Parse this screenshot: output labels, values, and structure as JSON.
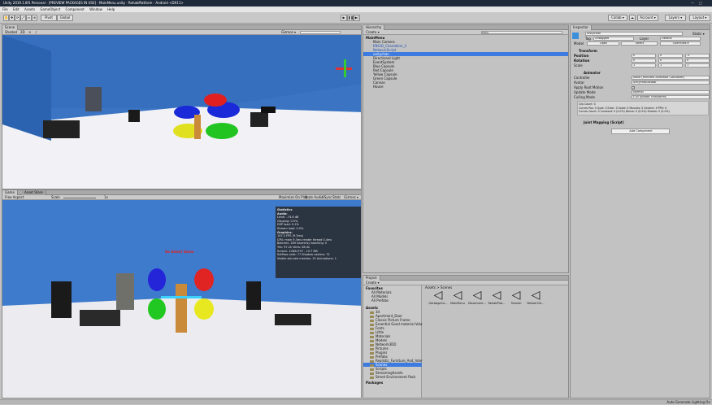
{
  "window": {
    "title": "Unity 2019.1.8f1 Personal - [PREVIEW PACKAGES IN USE] - MainMenu.unity - RehabPlatform - Android <DX11>",
    "minimize": "—",
    "maximize": "□"
  },
  "menu": [
    "File",
    "Edit",
    "Assets",
    "GameObject",
    "Component",
    "Window",
    "Help"
  ],
  "toolbar": {
    "pivot": "Pivot",
    "global": "Global",
    "collab": "Collab ▾",
    "account": "Account ▾",
    "layers": "Layers ▾",
    "layout": "Layout ▾"
  },
  "scene": {
    "tab": "Scene",
    "shaded": "Shaded",
    "mode2d": "2D",
    "gizmos": "Gizmos ▾"
  },
  "game": {
    "tab": "Game",
    "tab2": "Asset Store",
    "aspect": "Free Aspect",
    "scale": "Scale",
    "scale_value": "1x",
    "maximize": "Maximize On Play",
    "mute": "Mute Audio",
    "vsync": "VSync",
    "stats": "Stats",
    "gizmos": "Gizmos ▾",
    "red_text": "Go Select Game"
  },
  "stats_panel": {
    "title": "Statistics",
    "audio": "Audio:",
    "level": "Level: -74.8 dB",
    "clipping": "Clipping: 0.0%",
    "dsp": "DSP load: 0.1%",
    "stream": "Stream load: 0.0%",
    "graphics": "Graphics:",
    "fps": "107.2 FPS (9.3ms)",
    "cpu": "CPU: main 9.3ms  render thread 0.4ms",
    "batches": "Batches: 189   Saved by batching: 0",
    "tris": "Tris: 97.2k    Verts: 68.4k",
    "screen": "Screen: 1289x797 - 15.7 MB",
    "setpass": "SetPass calls: 77   Shadow casters: 72",
    "skinned": "Visible skinned meshes: 19  Animations: 1"
  },
  "hierarchy": {
    "tab": "Hierarchy",
    "create": "Create ▾",
    "search": "Q▾All",
    "items": [
      "MainMenu",
      "Main Camera",
      "ENGIO_Chandelier_2",
      "NetworkScript",
      "unitychan",
      "Directional Light",
      "EventSystem",
      "Blue Capsule",
      "Red Capsule",
      "Yellow Capsule",
      "Green Capsule",
      "Canvas",
      "House"
    ]
  },
  "project": {
    "tab": "Project",
    "create": "Create ▾",
    "favorites": "Favorites",
    "fav_items": [
      "All Materials",
      "All Models",
      "All Prefabs"
    ],
    "assets": "Assets",
    "folders": [
      "3d",
      "Apartment_Door",
      "Classic Picture Frame",
      "Essential Good material Vola",
      "Fonts",
      "Little",
      "Materials",
      "Models",
      "Network3DD",
      "Pictures",
      "Plugins",
      "Prefabs",
      "Realistic_Furniture_And_Inter",
      "Scenes",
      "Scripts",
      "StreamingAssets",
      "Street Environment Pack"
    ],
    "packages": "Packages",
    "breadcrumb": "Assets > Scenes",
    "scene_assets": [
      "GarbageCo...",
      "MainMenu",
      "Movement...",
      "RehabPlat...",
      "Tutorial",
      "WorkerCle..."
    ]
  },
  "inspector": {
    "tab": "Inspector",
    "object_name": "unitychan",
    "static": "Static ▾",
    "tag_label": "Tag",
    "tag_value": "Untagged",
    "layer_label": "Layer",
    "layer_value": "Default",
    "model_label": "Model",
    "open": "Open",
    "select": "Select",
    "overrides": "Overrides ▾",
    "transform": "Transform",
    "position": "Position",
    "pos": [
      "0",
      "0",
      "-5"
    ],
    "rotation": "Rotation",
    "rot": [
      "0",
      "0",
      "0"
    ],
    "scale": "Scale",
    "scl": [
      "1",
      "1",
      "1"
    ],
    "animator": "Animator",
    "controller": "Controller",
    "controller_value": "None (Runtime Animator Controller)",
    "avatar": "Avatar",
    "avatar_value": "unitychanAvatar",
    "apply_root": "Apply Root Motion",
    "update_mode": "Update Mode",
    "update_value": "Normal",
    "culling_mode": "Culling Mode",
    "culling_value": "Cull Update Transforms",
    "clip_info": "Clip Count: 0\nCurves Pos: 0 Quat: 0 Euler: 0 Scale: 0 Muscles: 0 Generic: 0 PPtr: 0\nCurves Count: 0 Constant: 0 (0.0%) Dense: 0 (0.0%) Stream: 0 (0.0%)",
    "joint_script": "Joint Mapping (Script)",
    "add_component": "Add Component"
  },
  "status": {
    "text": "Auto Generate Lighting On"
  },
  "colors": {
    "titlebar": "#1f2a3a",
    "selection": "#3d7be0",
    "panel": "#c2c2c2",
    "sky": "#2f6db8",
    "floor": "#e8e8ec"
  }
}
